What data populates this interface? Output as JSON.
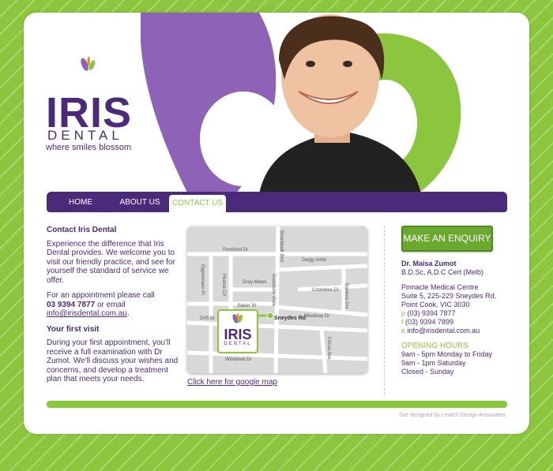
{
  "logo": {
    "brand": "IRIS",
    "sub": "DENTAL",
    "tagline": "where smiles blossom"
  },
  "nav": {
    "items": [
      {
        "label": "HOME"
      },
      {
        "label": "ABOUT US"
      },
      {
        "label": "CONTACT US"
      }
    ],
    "active": "CONTACT US"
  },
  "contact": {
    "heading": "Contact Iris Dental",
    "intro": "Experience the difference that Iris Dental provides. We welcome you to visit our friendly practice, and see for yourself the standard of service we offer.",
    "appointment_text": "For an appointment please call",
    "phone": "03 9394 7877",
    "or_email": " or email",
    "email": "info@irisdental.com.au",
    "first_visit_heading": "Your first visit",
    "first_visit_text": "During your first appointment, you'll receive a full examination with Dr Zumot. We'll discuss your wishes and concerns, and develop a treatment plan that meets your needs."
  },
  "map": {
    "streets": [
      "Ponsford Dr",
      "Boardwalk Bvd",
      "Dargy Ambl",
      "Oppermann Pl",
      "Pearce Crt",
      "Gray Mews",
      "Coombes Ct",
      "Banksia Grv",
      "Baker St",
      "Drift St",
      "Sneydes Rd",
      "Mowbray Dr",
      "Goddison Vista",
      "Circus Ave",
      "Windorah Dr"
    ],
    "link_label": "Click here for google map"
  },
  "enquiry_button": "MAKE AN ENQUIRY",
  "practice": {
    "doctor": "Dr. Maisa Zumot",
    "qualifications": "B.D.Sc, A.D.C Cert (Melb)",
    "centre": "Pinnacle Medical Centre",
    "address1": "Suite 5, 225-229 Sneydes Rd,",
    "address2": "Point Cook, VIC 3030",
    "phone_prefix": "p",
    "phone": "(03) 9394 7877",
    "fax_prefix": "f",
    "fax": "(03) 9394 7899",
    "email_prefix": "e",
    "email": "info@irisdental.com.au",
    "hours_title": "OPENING HOURS",
    "hours": [
      "9am - 5pm Monday to Friday",
      "9am - 1pm Saturday",
      "Closed - Sunday"
    ]
  },
  "footer": {
    "credit": "Site designed by Levitch Design Associates"
  },
  "colors": {
    "purple": "#4b2a7b",
    "green": "#8cc63f",
    "lilac": "#8e62b6",
    "orange": "#f08a1c"
  }
}
